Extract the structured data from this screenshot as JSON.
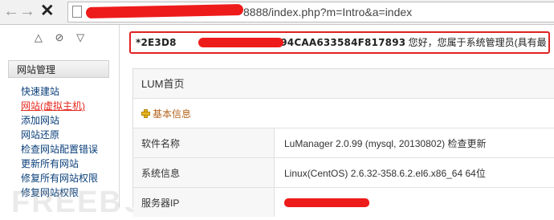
{
  "browser": {
    "back_icon": "back-arrow-icon",
    "forward_icon": "forward-arrow-icon",
    "stop_icon": "close-icon",
    "url_visible": "8888/index.php?m=Intro&a=index"
  },
  "sidebar": {
    "tools": [
      "△",
      "⊘",
      "▽"
    ],
    "group_title": "网站管理",
    "items": [
      {
        "label": "快速建站"
      },
      {
        "label": "网站(虚拟主机)"
      },
      {
        "label": "添加网站"
      },
      {
        "label": "网站还原"
      },
      {
        "label": "检查网站配置错误"
      },
      {
        "label": "更新所有网站"
      },
      {
        "label": "修复所有网站权限"
      },
      {
        "label": "修复网站权限"
      }
    ]
  },
  "notice": {
    "code_prefix": "*2E3D8",
    "code_suffix": "C594CAA633584F817893",
    "message": "您好，您属于系统管理员(具有最"
  },
  "panel": {
    "title": "LUM首页",
    "section": "基本信息",
    "rows": [
      {
        "key": "软件名称",
        "value": "LuManager 2.0.99 (mysql, 20130802) 检查更新"
      },
      {
        "key": "系统信息",
        "value": "Linux(CentOS)    2.6.32-358.6.2.el6.x86_64    64位"
      },
      {
        "key": "服务器IP",
        "value": ""
      }
    ]
  },
  "watermark": "FREEBUF",
  "colors": {
    "redaction": "#ee1b1b",
    "highlight_border": "#e02222",
    "active_link": "#e5261b",
    "link": "#0a3f7a",
    "section_head": "#b3621c"
  }
}
